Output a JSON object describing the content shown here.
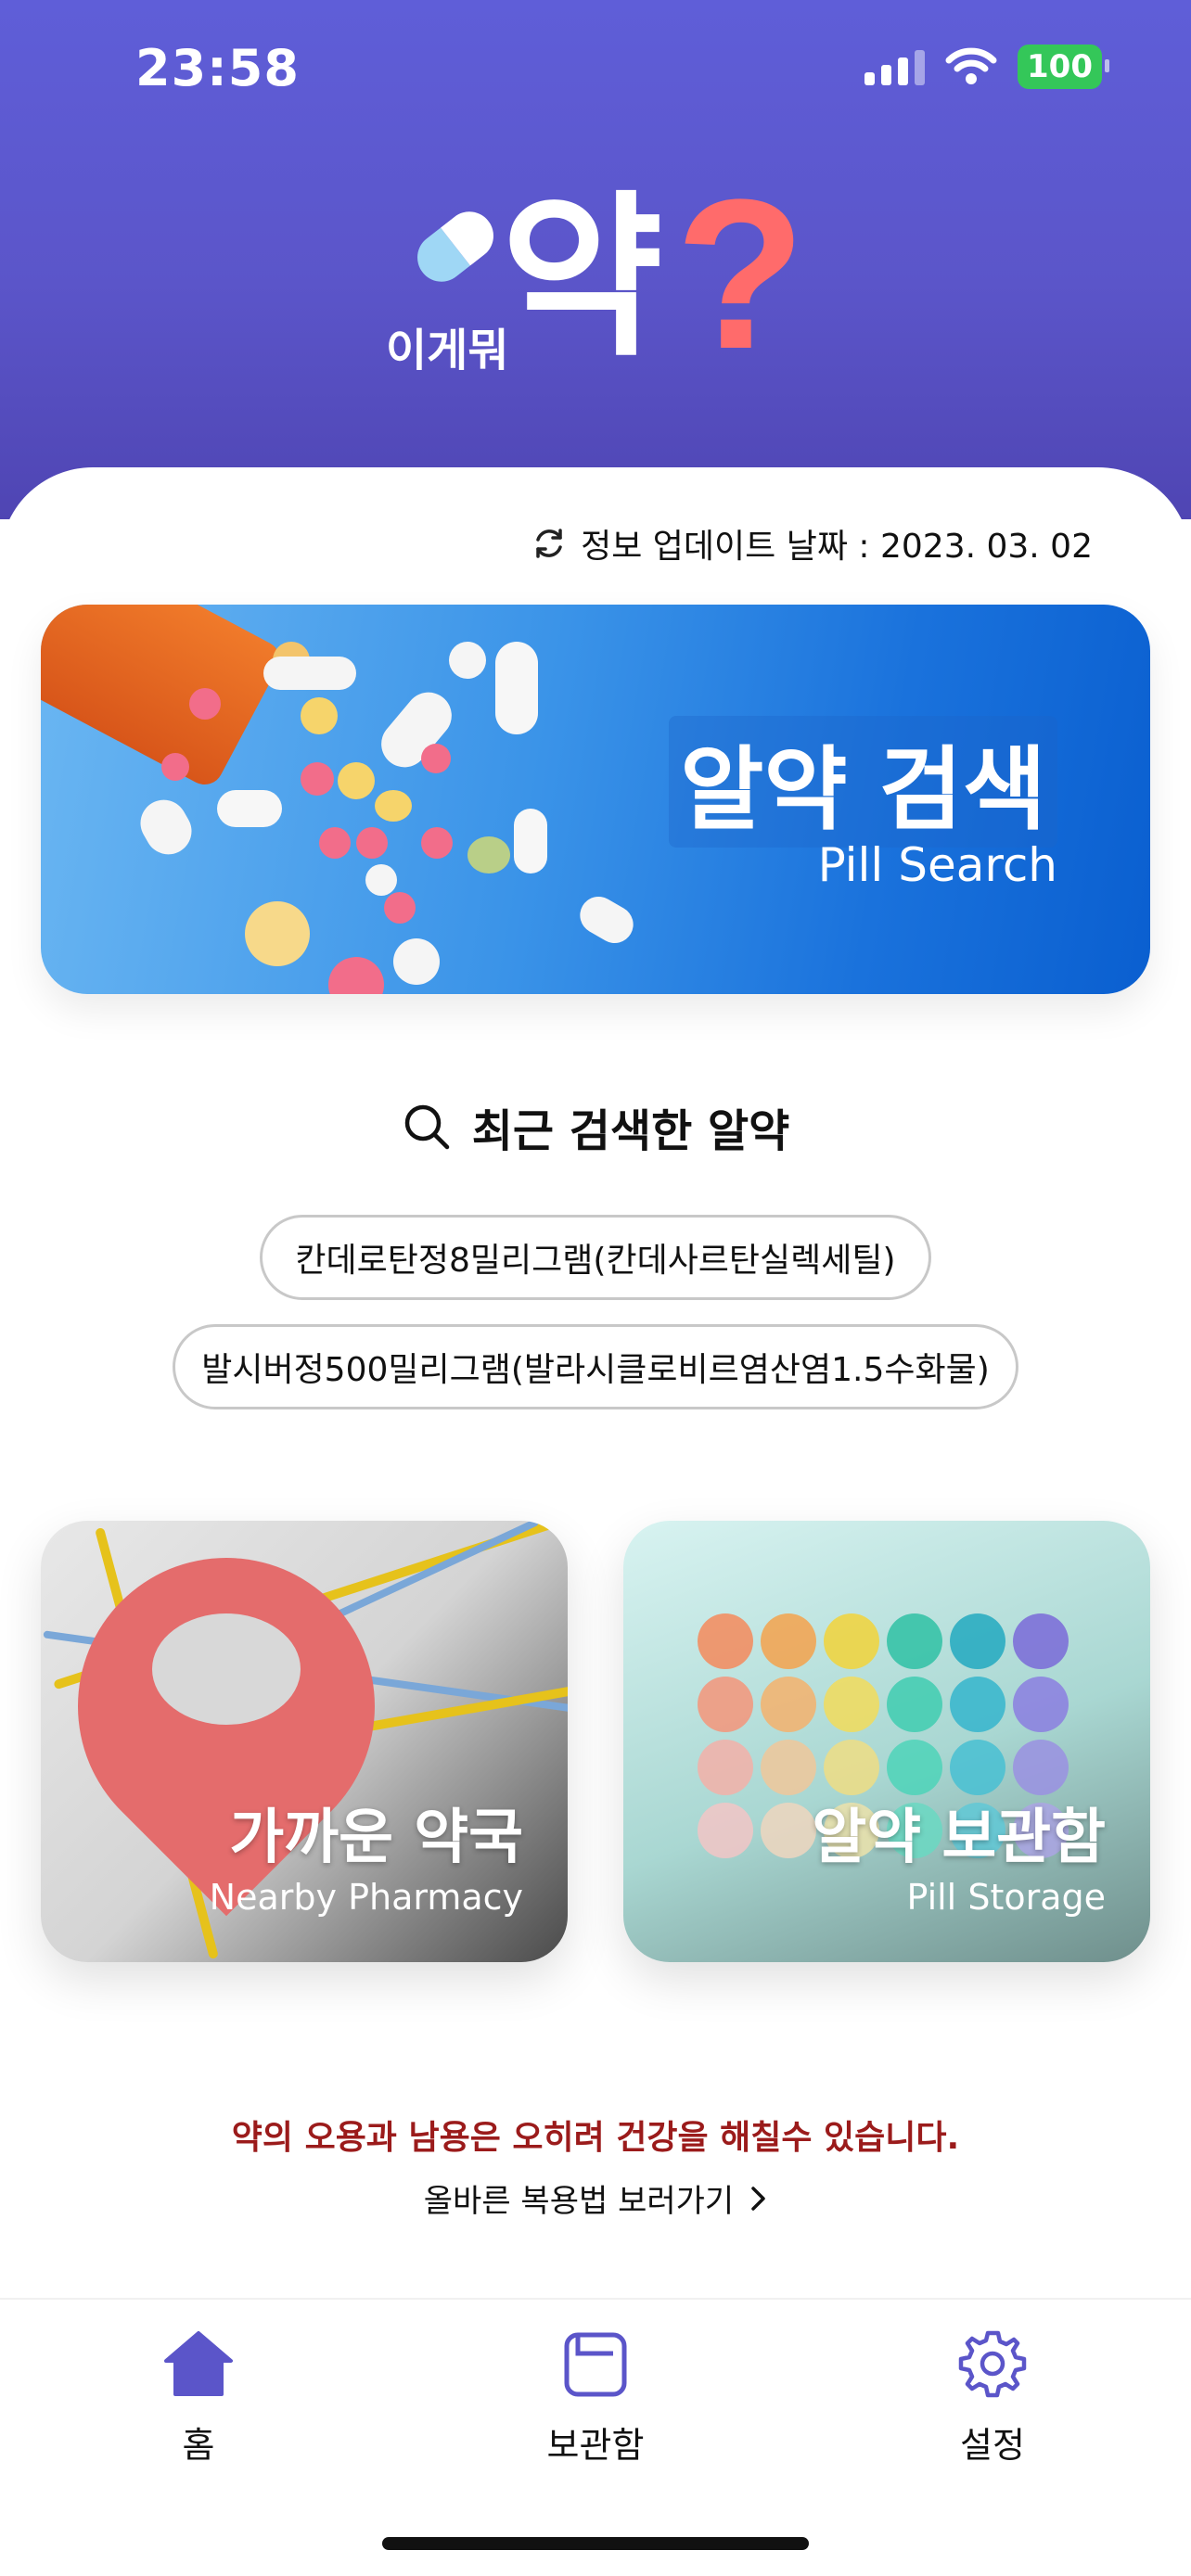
{
  "status_bar": {
    "time": "23:58",
    "battery": "100"
  },
  "logo": {
    "small_text": "이게뭐",
    "big_text": "약",
    "question": "?"
  },
  "update_info": {
    "label": "정보 업데이트 날짜 : 2023. 03. 02"
  },
  "pill_search": {
    "title": "알약 검색",
    "subtitle": "Pill Search"
  },
  "recent": {
    "title": "최근 검색한 알약",
    "items": [
      "칸데로탄정8밀리그램(칸데사르탄실렉세틸)",
      "발시버정500밀리그램(발라시클로비르염산염1.5수화물)"
    ]
  },
  "cards": {
    "pharmacy": {
      "title": "가까운 약국",
      "subtitle": "Nearby Pharmacy"
    },
    "storage": {
      "title": "알약 보관함",
      "subtitle": "Pill Storage"
    }
  },
  "warning": {
    "text": "약의 오용과 남용은 오히려 건강을 해칠수 있습니다.",
    "link": "올바른 복용법 보러가기"
  },
  "tabs": [
    {
      "label": "홈",
      "icon": "home-icon"
    },
    {
      "label": "보관함",
      "icon": "folder-icon"
    },
    {
      "label": "설정",
      "icon": "gear-icon"
    }
  ],
  "colors": {
    "accent": "#5b55c9",
    "warning": "#9b1b1b",
    "question_mark": "#ff6b6b"
  }
}
